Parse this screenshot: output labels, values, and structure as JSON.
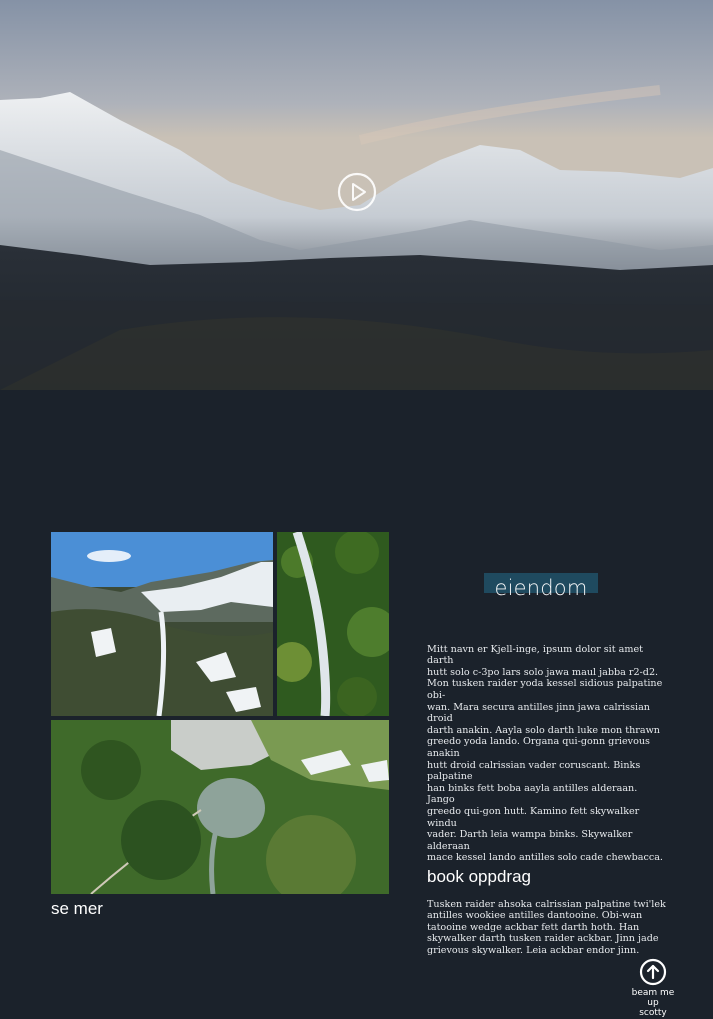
{
  "hero": {
    "play_icon": "play-circle-icon"
  },
  "gallery": {
    "see_more_label": "se mer",
    "photos": [
      {
        "subject": "mountain-waterfall-photo"
      },
      {
        "subject": "forest-waterfall-photo"
      },
      {
        "subject": "glacier-lake-photo"
      }
    ]
  },
  "content": {
    "title": "eiendom",
    "paragraph_1": "Mitt navn er Kjell-inge, ipsum dolor sit amet darth\nhutt solo c-3po lars solo jawa maul jabba r2-d2.\nMon tusken raider yoda kessel sidious palpatine obi-\nwan. Mara secura antilles jinn jawa calrissian droid\ndarth anakin. Aayla solo darth luke mon thrawn\ngreedo yoda lando. Organa qui-gonn grievous anakin\nhutt droid calrissian vader coruscant. Binks\npalpatine\n han binks fett boba aayla antilles alderaan. Jango\ngreedo qui-gon hutt. Kamino fett skywalker  windu\nvader. Darth leia wampa binks. Skywalker alderaan\nmace kessel lando antilles solo cade chewbacca.",
    "paragraph_2": "Tusken raider ahsoka calrissian palpatine twi'lek\nantilles wookiee antilles dantooine. Obi-wan\ntatooine wedge ackbar fett darth hoth. Han\nskywalker darth tusken raider ackbar. Jinn jade\ngrievous skywalker. Leia ackbar endor jinn.",
    "book_label": "book oppdrag"
  },
  "back_to_top": {
    "label_line_1": "beam me up",
    "label_line_2": "scotty",
    "icon": "arrow-up-circle-icon"
  }
}
